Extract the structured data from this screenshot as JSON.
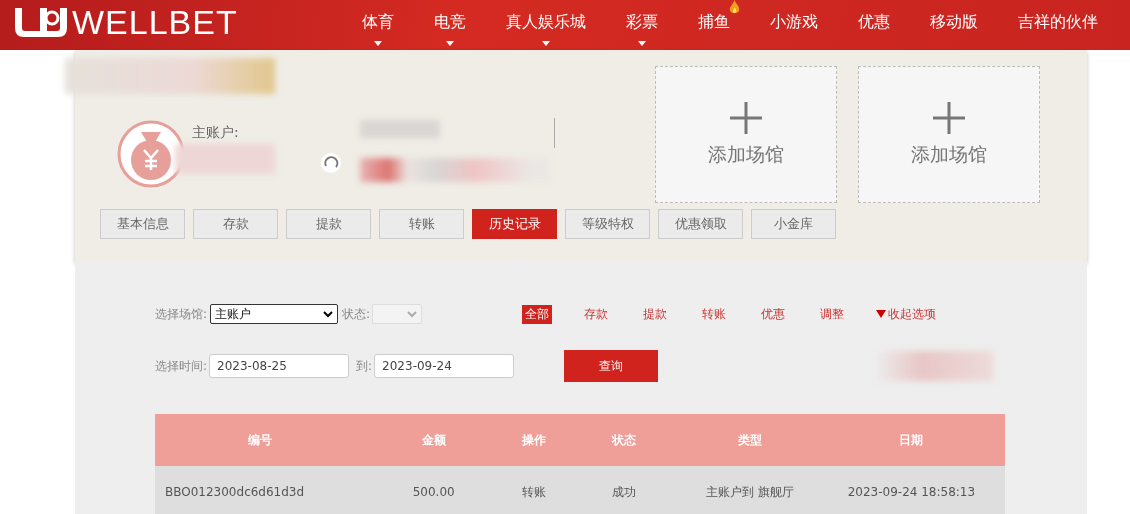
{
  "header": {
    "logo": "WELLBET",
    "nav": [
      {
        "label": "体育",
        "dropdown": true,
        "hot": false
      },
      {
        "label": "电竞",
        "dropdown": true,
        "hot": false
      },
      {
        "label": "真人娱乐城",
        "dropdown": true,
        "hot": false
      },
      {
        "label": "彩票",
        "dropdown": true,
        "hot": false
      },
      {
        "label": "捕鱼",
        "dropdown": false,
        "hot": true
      },
      {
        "label": "小游戏",
        "dropdown": false,
        "hot": false
      },
      {
        "label": "优惠",
        "dropdown": false,
        "hot": false
      },
      {
        "label": "移动版",
        "dropdown": false,
        "hot": false
      },
      {
        "label": "吉祥的伙伴",
        "dropdown": false,
        "hot": false
      }
    ]
  },
  "account": {
    "label": "主账户:",
    "venues": [
      {
        "label": "添加场馆"
      },
      {
        "label": "添加场馆"
      }
    ],
    "tabs": [
      {
        "label": "基本信息",
        "selected": false
      },
      {
        "label": "存款",
        "selected": false
      },
      {
        "label": "提款",
        "selected": false
      },
      {
        "label": "转账",
        "selected": false
      },
      {
        "label": "历史记录",
        "selected": true
      },
      {
        "label": "等级特权",
        "selected": false
      },
      {
        "label": "优惠领取",
        "selected": false
      },
      {
        "label": "小金库",
        "selected": false
      }
    ]
  },
  "filters": {
    "venue_label": "选择场馆:",
    "venue_value": "主账户",
    "status_label": "状态:",
    "time_label": "选择时间:",
    "from": "2023-08-25",
    "to_label": "到:",
    "to": "2023-09-24",
    "query": "查询",
    "types": [
      {
        "label": "全部",
        "selected": true
      },
      {
        "label": "存款",
        "selected": false
      },
      {
        "label": "提款",
        "selected": false
      },
      {
        "label": "转账",
        "selected": false
      },
      {
        "label": "优惠",
        "selected": false
      },
      {
        "label": "调整",
        "selected": false
      }
    ],
    "collapse": "收起选项"
  },
  "table": {
    "columns": [
      "编号",
      "金额",
      "操作",
      "状态",
      "类型",
      "日期"
    ],
    "rows": [
      [
        "BBO012300dc6d61d3d",
        "500.00",
        "转账",
        "成功",
        "主账户到 旗舰厅",
        "2023-09-24 18:58:13"
      ]
    ]
  }
}
